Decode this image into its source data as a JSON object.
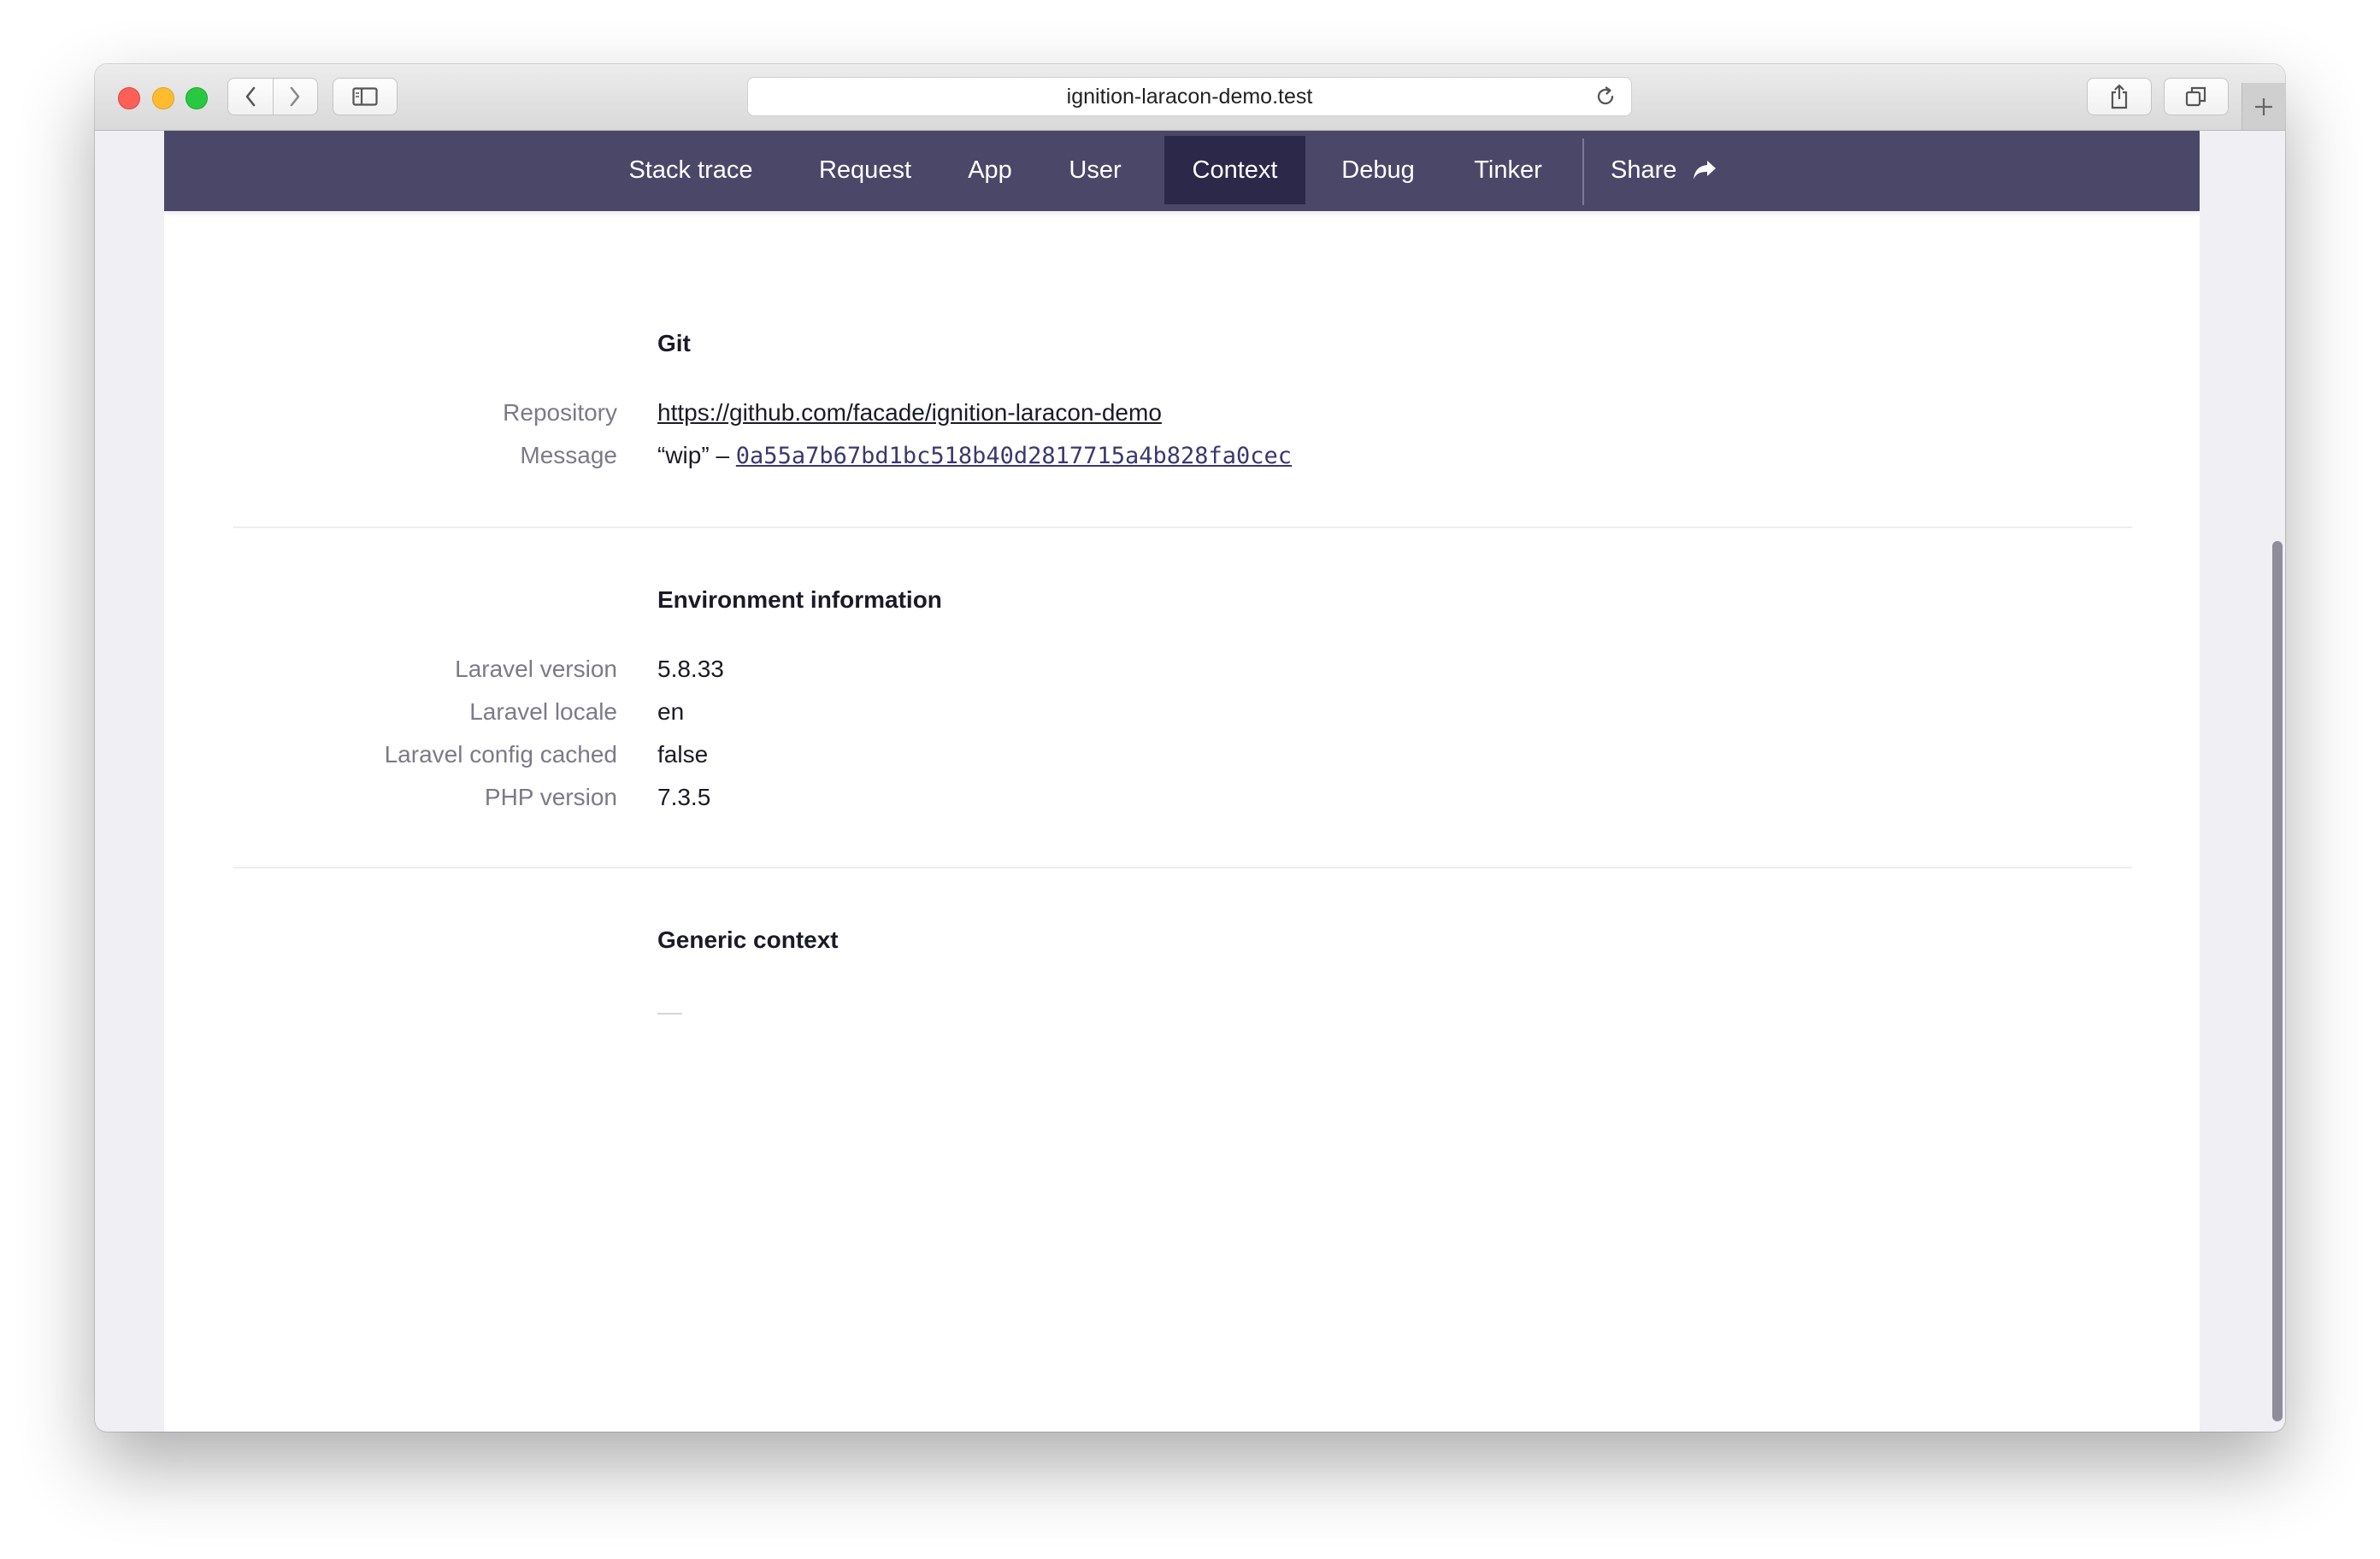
{
  "browser": {
    "url": "ignition-laracon-demo.test"
  },
  "nav": {
    "items": [
      {
        "label": "Stack trace"
      },
      {
        "label": "Request"
      },
      {
        "label": "App"
      },
      {
        "label": "User"
      },
      {
        "label": "Context"
      },
      {
        "label": "Debug"
      },
      {
        "label": "Tinker"
      }
    ],
    "active": "Context",
    "share_label": "Share"
  },
  "git": {
    "title": "Git",
    "repository_label": "Repository",
    "repository_url": "https://github.com/facade/ignition-laracon-demo",
    "message_label": "Message",
    "message_text": "“wip” –",
    "commit_hash": "0a55a7b67bd1bc518b40d2817715a4b828fa0cec"
  },
  "environment": {
    "title": "Environment information",
    "rows": [
      {
        "label": "Laravel version",
        "value": "5.8.33"
      },
      {
        "label": "Laravel locale",
        "value": "en"
      },
      {
        "label": "Laravel config cached",
        "value": "false"
      },
      {
        "label": "PHP version",
        "value": "7.3.5"
      }
    ]
  },
  "generic": {
    "title": "Generic context"
  },
  "colors": {
    "navbar": "#4b4769",
    "nav_active": "#2c2849",
    "scroll_thumb": "#8e8c9d"
  }
}
